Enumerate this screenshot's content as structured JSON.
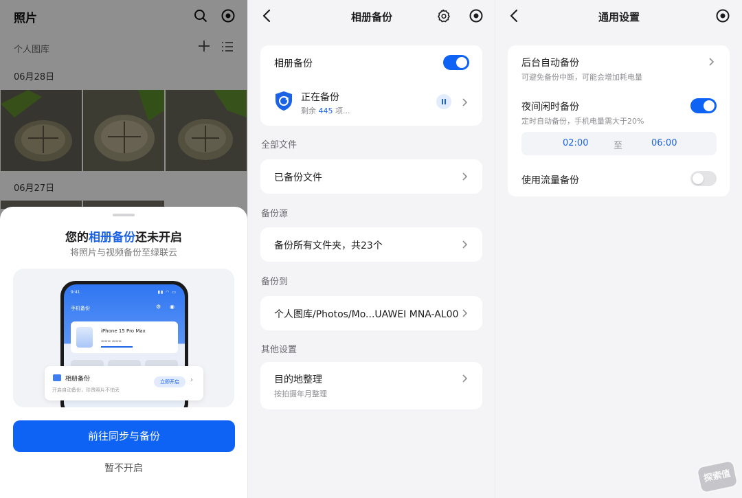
{
  "panel1": {
    "title": "照片",
    "library": "个人图库",
    "date1": "06月28日",
    "date2": "06月27日",
    "sheet": {
      "title_pre": "您的",
      "title_highlight": "相册备份",
      "title_post": "还未开启",
      "subtitle": "将照片与视频备份至绿联云",
      "illustration": {
        "time": "9:41",
        "app_title": "手机备份",
        "device": "iPhone 15 Pro Max",
        "banner_title": "相册备份",
        "banner_subtitle": "开启自动备份，珍贵照片不怕丢",
        "banner_button": "立即开启"
      },
      "primary_button": "前往同步与备份",
      "secondary_button": "暂不开启"
    }
  },
  "panel2": {
    "title": "相册备份",
    "backup_toggle_label": "相册备份",
    "backup_toggle_on": true,
    "status_title": "正在备份",
    "status_remaining_pre": "剩余 ",
    "status_remaining_count": "445",
    "status_remaining_post": " 项...",
    "sections": [
      {
        "header": "全部文件",
        "row": "已备份文件"
      },
      {
        "header": "备份源",
        "row": "备份所有文件夹，共23个"
      },
      {
        "header": "备份到",
        "row": "个人图库/Photos/Mo...UAWEI MNA-AL00"
      },
      {
        "header": "其他设置",
        "row": "目的地整理",
        "row_sub": "按拍摄年月整理"
      }
    ]
  },
  "panel3": {
    "title": "通用设置",
    "auto_backup": {
      "label": "后台自动备份",
      "sub": "可避免备份中断，可能会增加耗电量"
    },
    "night_backup": {
      "label": "夜间闲时备份",
      "sub": "定时自动备份，手机电量需大于20%",
      "on": true,
      "start": "02:00",
      "to": "至",
      "end": "06:00"
    },
    "cellular_backup": {
      "label": "使用流量备份",
      "on": false
    }
  },
  "watermark": "探索值",
  "colors": {
    "accent": "#0e62f4",
    "background": "#f4f4f6"
  }
}
